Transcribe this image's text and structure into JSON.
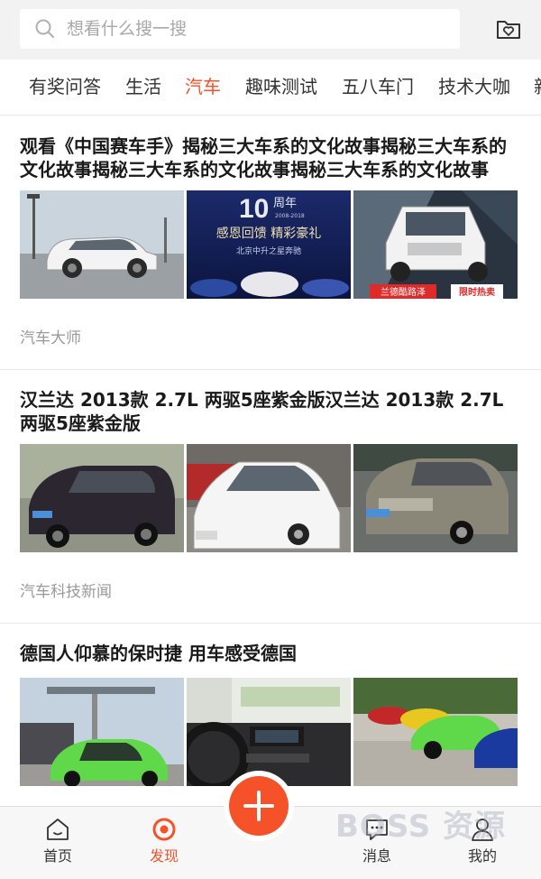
{
  "search": {
    "placeholder": "想看什么搜一搜"
  },
  "colors": {
    "accent": "#f5522a",
    "header_bg": "#f2f2f2",
    "muted": "#999999"
  },
  "icons": {
    "search": "search-icon",
    "favorite_folder": "heart-folder-icon"
  },
  "tabs": [
    {
      "label": "有奖问答",
      "active": false
    },
    {
      "label": "生活",
      "active": false
    },
    {
      "label": "汽车",
      "active": true
    },
    {
      "label": "趣味测试",
      "active": false
    },
    {
      "label": "五八车门",
      "active": false
    },
    {
      "label": "技术大咖",
      "active": false
    },
    {
      "label": "新",
      "active": false
    }
  ],
  "articles": [
    {
      "title": "观看《中国赛车手》揭秘三大车系的文化故事揭秘三大车系的文化故事揭秘三大车系的文化故事揭秘三大车系的文化故事",
      "source": "汽车大师",
      "images": [
        {
          "desc": "white SUV"
        },
        {
          "desc": "ad banner",
          "text_top": "周年",
          "text_mid": "感恩回馈 精彩豪礼",
          "text_bottom": "北京中升之星奔驰",
          "big_number": "10",
          "years": "2008-2018"
        },
        {
          "desc": "white Land Cruiser",
          "badge_left": "兰德酷路泽",
          "badge_right": "限时热卖"
        }
      ]
    },
    {
      "title": "汉兰达 2013款 2.7L 两驱5座紫金版汉兰达 2013款 2.7L 两驱5座紫金版",
      "source": "汽车科技新闻",
      "images": [
        {
          "desc": "dark minivan"
        },
        {
          "desc": "white sedan"
        },
        {
          "desc": "grey sedan"
        }
      ]
    },
    {
      "title": "德国人仰慕的保时捷 用车感受德国",
      "source": "",
      "images": [
        {
          "desc": "green Porsche"
        },
        {
          "desc": "car interior"
        },
        {
          "desc": "row of sports cars"
        }
      ]
    }
  ],
  "bottom_nav": [
    {
      "label": "首页",
      "icon": "home-icon",
      "active": false
    },
    {
      "label": "发现",
      "icon": "discover-icon",
      "active": true
    },
    {
      "label": "消息",
      "icon": "message-icon",
      "active": false
    },
    {
      "label": "我的",
      "icon": "profile-icon",
      "active": false
    }
  ],
  "watermark": "BOSS 资源"
}
